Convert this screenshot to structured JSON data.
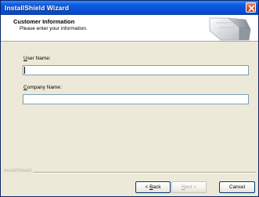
{
  "window": {
    "title": "InstallShield Wizard",
    "close_icon": "close-icon"
  },
  "header": {
    "title": "Customer Information",
    "subtitle": "Please enter your information."
  },
  "form": {
    "user_name": {
      "label_mnemonic": "U",
      "label_rest": "ser Name:",
      "value": ""
    },
    "company_name": {
      "label_mnemonic": "C",
      "label_rest": "ompany Name:",
      "value": ""
    }
  },
  "footer": {
    "brand": "InstallShield"
  },
  "buttons": {
    "back": {
      "prefix": "< ",
      "mnemonic": "B",
      "rest": "ack"
    },
    "next": {
      "mnemonic": "N",
      "rest": "ext >"
    },
    "cancel": {
      "label": "Cancel"
    }
  },
  "colors": {
    "titlebar": "#0550d8",
    "dialog_face": "#ece9d8",
    "input_border": "#7f9db9",
    "button_border": "#003c74",
    "disabled_text": "#aca899"
  }
}
